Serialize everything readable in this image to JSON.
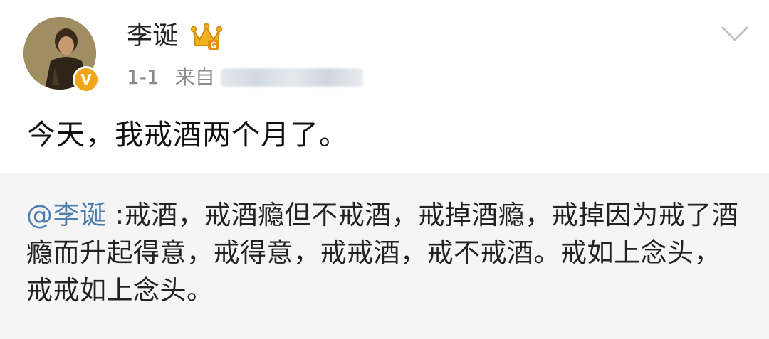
{
  "post": {
    "username": "李诞",
    "verified_badge": "V",
    "date": "1-1",
    "source_prefix": "来自",
    "text": "今天，我戒酒两个月了。"
  },
  "repost": {
    "mention": "@李诞",
    "text": " :戒酒，戒酒瘾但不戒酒，戒掉酒瘾，戒掉因为戒了酒瘾而升起得意，戒得意，戒戒酒，戒不戒酒。戒如上念头，戒戒如上念头。"
  },
  "icons": {
    "crown": "vip-crown-icon",
    "chevron": "chevron-down-icon"
  },
  "colors": {
    "mention": "#4f7dae",
    "verified": "#f0a417",
    "repost_bg": "#f5f5f5"
  }
}
